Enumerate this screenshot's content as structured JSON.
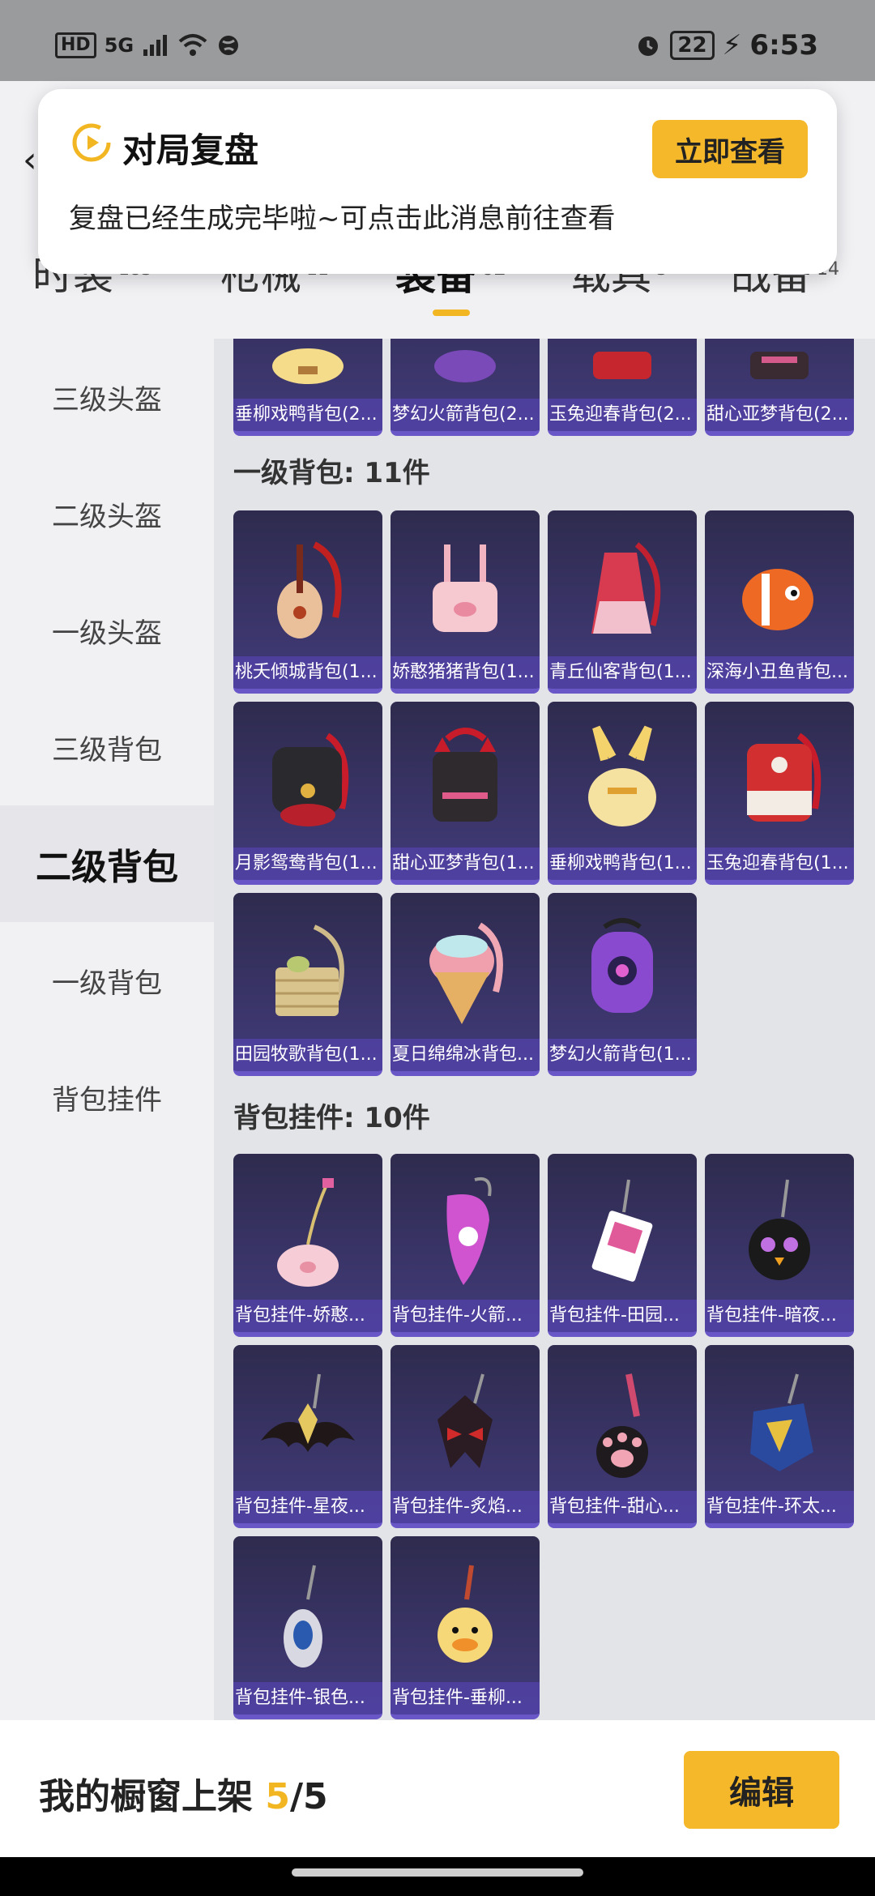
{
  "status": {
    "network": "5G",
    "hd": "HD",
    "battery": "22",
    "time": "6:53"
  },
  "notification": {
    "title": "对局复盘",
    "button": "立即查看",
    "message": "复盘已经生成完毕啦~可点击此消息前往查看"
  },
  "tabs": [
    {
      "label": "时装",
      "count": "183"
    },
    {
      "label": "枪械",
      "count": "11"
    },
    {
      "label": "装备",
      "count": "62"
    },
    {
      "label": "载具",
      "count": "3"
    },
    {
      "label": "战备",
      "count": "14"
    }
  ],
  "sidebar": {
    "items": [
      {
        "label": "三级头盔"
      },
      {
        "label": "二级头盔"
      },
      {
        "label": "一级头盔"
      },
      {
        "label": "三级背包"
      },
      {
        "label": "二级背包"
      },
      {
        "label": "一级背包"
      },
      {
        "label": "背包挂件"
      }
    ]
  },
  "content": {
    "top_row": [
      "垂柳戏鸭背包(2...",
      "梦幻火箭背包(2...",
      "玉兔迎春背包(2...",
      "甜心亚梦背包(2..."
    ],
    "section_backpack1": {
      "title": "一级背包: 11件",
      "items": [
        "桃夭倾城背包(1...",
        "娇憨猪猪背包(1...",
        "青丘仙客背包(1...",
        "深海小丑鱼背包...",
        "月影鸳鸯背包(1...",
        "甜心亚梦背包(1...",
        "垂柳戏鸭背包(1...",
        "玉兔迎春背包(1...",
        "田园牧歌背包(1...",
        "夏日绵绵冰背包...",
        "梦幻火箭背包(1..."
      ]
    },
    "section_pendant": {
      "title": "背包挂件: 10件",
      "items": [
        "背包挂件-娇憨...",
        "背包挂件-火箭...",
        "背包挂件-田园...",
        "背包挂件-暗夜...",
        "背包挂件-星夜...",
        "背包挂件-炙焰...",
        "背包挂件-甜心...",
        "背包挂件-环太...",
        "背包挂件-银色...",
        "背包挂件-垂柳..."
      ]
    }
  },
  "bottom": {
    "shelf_prefix": "我的橱窗上架 ",
    "shelf_current": "5",
    "shelf_total": "/5",
    "edit_button": "编辑"
  }
}
